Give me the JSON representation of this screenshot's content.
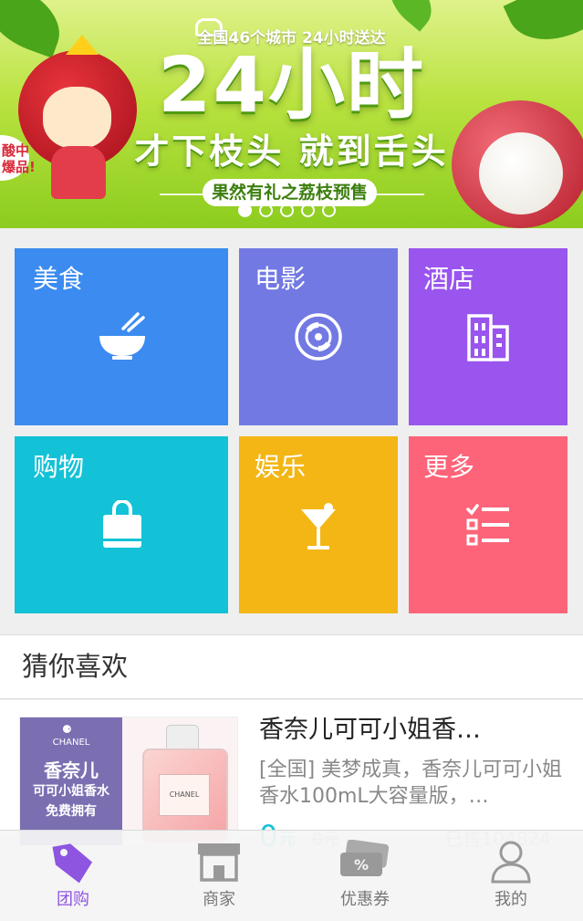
{
  "banner": {
    "top_text": "全国46个城市 24小时送达",
    "title": "24小时",
    "slogan": "才下枝头 就到舌头",
    "presale": "果然有礼之荔枝预售",
    "bubble": "酸中\n爆品!",
    "page_count": 5,
    "active_page": 0
  },
  "categories": [
    {
      "label": "美食",
      "icon": "bowl-icon",
      "color": "#3b8bf0"
    },
    {
      "label": "电影",
      "icon": "film-reel-icon",
      "color": "#7279e3"
    },
    {
      "label": "酒店",
      "icon": "building-icon",
      "color": "#9955ee"
    },
    {
      "label": "购物",
      "icon": "shopping-bag-icon",
      "color": "#13c2d6"
    },
    {
      "label": "娱乐",
      "icon": "cocktail-icon",
      "color": "#f3b615"
    },
    {
      "label": "更多",
      "icon": "checklist-icon",
      "color": "#fd6479"
    }
  ],
  "guess": {
    "header": "猜你喜欢",
    "items": [
      {
        "title": "香奈儿可可小姐香…",
        "description": "[全国] 美梦成真，香奈儿可可小姐香水100mL大容量版，…",
        "price": "0",
        "price_unit": "元",
        "original_price": "0元",
        "sold": "已售104824",
        "image": {
          "brand": "CHANEL",
          "line1": "香奈儿",
          "line2": "可可小姐香水",
          "line3": "免费拥有"
        }
      }
    ]
  },
  "tabs": [
    {
      "label": "团购",
      "icon": "tag-icon",
      "active": true
    },
    {
      "label": "商家",
      "icon": "store-icon",
      "active": false
    },
    {
      "label": "优惠券",
      "icon": "coupon-icon",
      "active": false
    },
    {
      "label": "我的",
      "icon": "user-icon",
      "active": false
    }
  ],
  "colors": {
    "accent": "#8e55e0",
    "price": "#13c2d6"
  }
}
